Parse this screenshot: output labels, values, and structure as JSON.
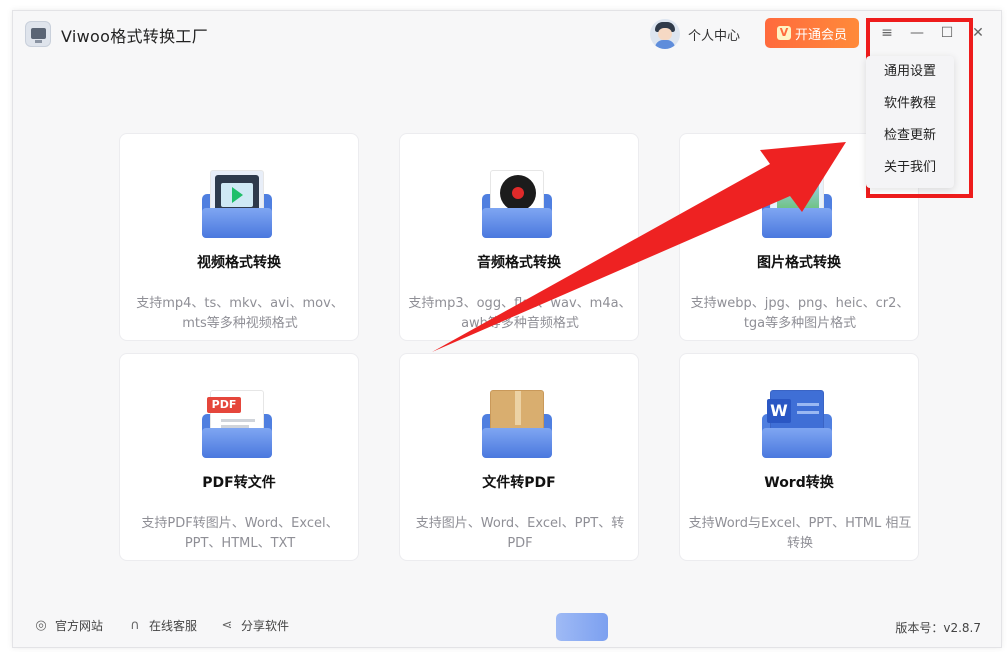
{
  "app": {
    "title": "Viwoo格式转换工厂"
  },
  "header": {
    "user_label": "个人中心",
    "vip_label": "开通会员",
    "vip_icon_text": "V",
    "menu_icon": "≡",
    "min_icon": "—",
    "max_icon": "☐",
    "close_icon": "✕"
  },
  "menu": {
    "items": [
      {
        "label": "通用设置"
      },
      {
        "label": "软件教程"
      },
      {
        "label": "检查更新"
      },
      {
        "label": "关于我们"
      }
    ]
  },
  "cards": [
    {
      "title": "视频格式转换",
      "desc": "支持mp4、ts、mkv、avi、mov、mts等多种视频格式",
      "icon": "video-file-icon"
    },
    {
      "title": "音频格式转换",
      "desc": "支持mp3、ogg、flac、wav、m4a、awb等多种音频格式",
      "icon": "audio-file-icon"
    },
    {
      "title": "图片格式转换",
      "desc": "支持webp、jpg、png、heic、cr2、tga等多种图片格式",
      "icon": "image-file-icon"
    },
    {
      "title": "PDF转文件",
      "desc": "支持PDF转图片、Word、Excel、PPT、HTML、TXT",
      "icon": "pdf-file-icon",
      "badge": "PDF"
    },
    {
      "title": "文件转PDF",
      "desc": "支持图片、Word、Excel、PPT、转PDF",
      "icon": "archive-file-icon"
    },
    {
      "title": "Word转换",
      "desc": "支持Word与Excel、PPT、HTML 相互转换",
      "icon": "word-file-icon",
      "badge": "W"
    }
  ],
  "footer": {
    "links": [
      {
        "label": "官方网站",
        "icon": "globe-icon"
      },
      {
        "label": "在线客服",
        "icon": "headset-icon"
      },
      {
        "label": "分享软件",
        "icon": "share-icon"
      }
    ],
    "version": "版本号：v2.8.7"
  },
  "colors": {
    "accent": "#ff6a3d",
    "highlight": "#ee1c1c",
    "folder": "#4f7fe0"
  }
}
